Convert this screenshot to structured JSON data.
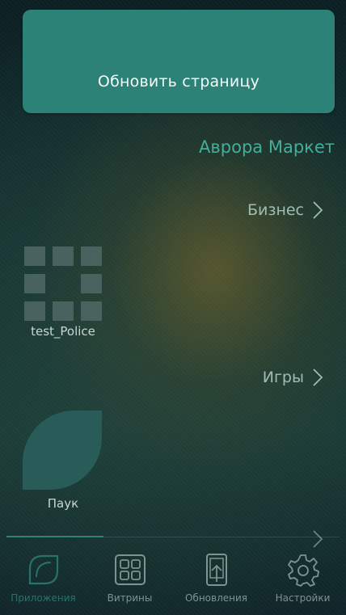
{
  "update_button": {
    "label": "Обновить страницу"
  },
  "market": {
    "title": "Аврора Маркет"
  },
  "categories": [
    {
      "label": "Бизнес"
    },
    {
      "label": "Игры"
    },
    {
      "label": ""
    }
  ],
  "apps": [
    {
      "name": "test_Police",
      "icon": "grid-app-icon"
    },
    {
      "name": "Паук",
      "icon": "leaf-app-icon"
    }
  ],
  "tabbar": {
    "active_index": 0,
    "tabs": [
      {
        "label": "Приложения",
        "icon": "leaf-outline-icon"
      },
      {
        "label": "Витрины",
        "icon": "showcase-grid-icon"
      },
      {
        "label": "Обновления",
        "icon": "phone-update-icon"
      },
      {
        "label": "Настройки",
        "icon": "gear-icon"
      }
    ]
  },
  "colors": {
    "accent": "#2d8277",
    "title": "#45ad9c",
    "tab_active": "#277369",
    "tab_inactive": "#7d948f"
  }
}
